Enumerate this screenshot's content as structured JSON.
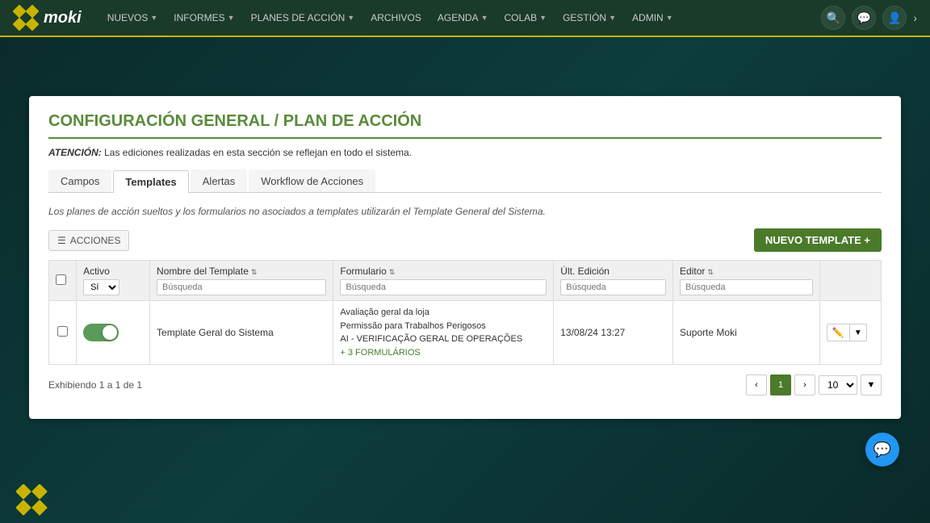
{
  "navbar": {
    "logo_text": "moki",
    "items": [
      {
        "label": "NUEVOS",
        "has_arrow": true
      },
      {
        "label": "INFORMES",
        "has_arrow": true
      },
      {
        "label": "PLANES DE ACCIÓN",
        "has_arrow": true
      },
      {
        "label": "ARCHIVOS",
        "has_arrow": false
      },
      {
        "label": "AGENDA",
        "has_arrow": true
      },
      {
        "label": "COLAB",
        "has_arrow": true
      },
      {
        "label": "GESTIÓN",
        "has_arrow": true
      },
      {
        "label": "ADMIN",
        "has_arrow": true
      }
    ]
  },
  "page": {
    "title": "CONFIGURACIÓN GENERAL / PLAN DE ACCIÓN",
    "attention_label": "ATENCIÓN:",
    "attention_text": " Las ediciones realizadas en esta sección se reflejan en todo el sistema.",
    "note": "Los planes de acción sueltos y los formularios no asociados a templates utilizarán el Template General del Sistema.",
    "tabs": [
      {
        "label": "Campos",
        "active": false
      },
      {
        "label": "Templates",
        "active": true
      },
      {
        "label": "Alertas",
        "active": false
      },
      {
        "label": "Workflow de Acciones",
        "active": false
      }
    ],
    "actions_label": "ACCIONES",
    "new_template_label": "NUEVO TEMPLATE +",
    "table": {
      "columns": [
        {
          "label": "",
          "key": "checkbox"
        },
        {
          "label": "Activo",
          "key": "activo",
          "sortable": false
        },
        {
          "label": "Nombre del Template",
          "key": "nombre",
          "sortable": true
        },
        {
          "label": "Formulario",
          "key": "formulario",
          "sortable": true
        },
        {
          "label": "Últ. Edición",
          "key": "edicion",
          "sortable": false
        },
        {
          "label": "Editor",
          "key": "editor",
          "sortable": true
        },
        {
          "label": "",
          "key": "actions"
        }
      ],
      "search_placeholder": "Búsqueda",
      "rows": [
        {
          "activo_value": "Sí",
          "toggle_on": true,
          "nombre": "Template Geral do Sistema",
          "formularios": [
            "Avaliação geral da loja",
            "Permissão para Trabalhos Perigosos",
            "AI - VERIFICAÇÃO GERAL DE OPERAÇÕES"
          ],
          "more_formularios": "+ 3 FORMULÁRIOS",
          "edicion": "13/08/24 13:27",
          "editor": "Suporte Moki"
        }
      ]
    },
    "pagination": {
      "info": "Exhibiendo 1 a 1 de 1",
      "current_page": 1,
      "page_size": 10
    }
  }
}
